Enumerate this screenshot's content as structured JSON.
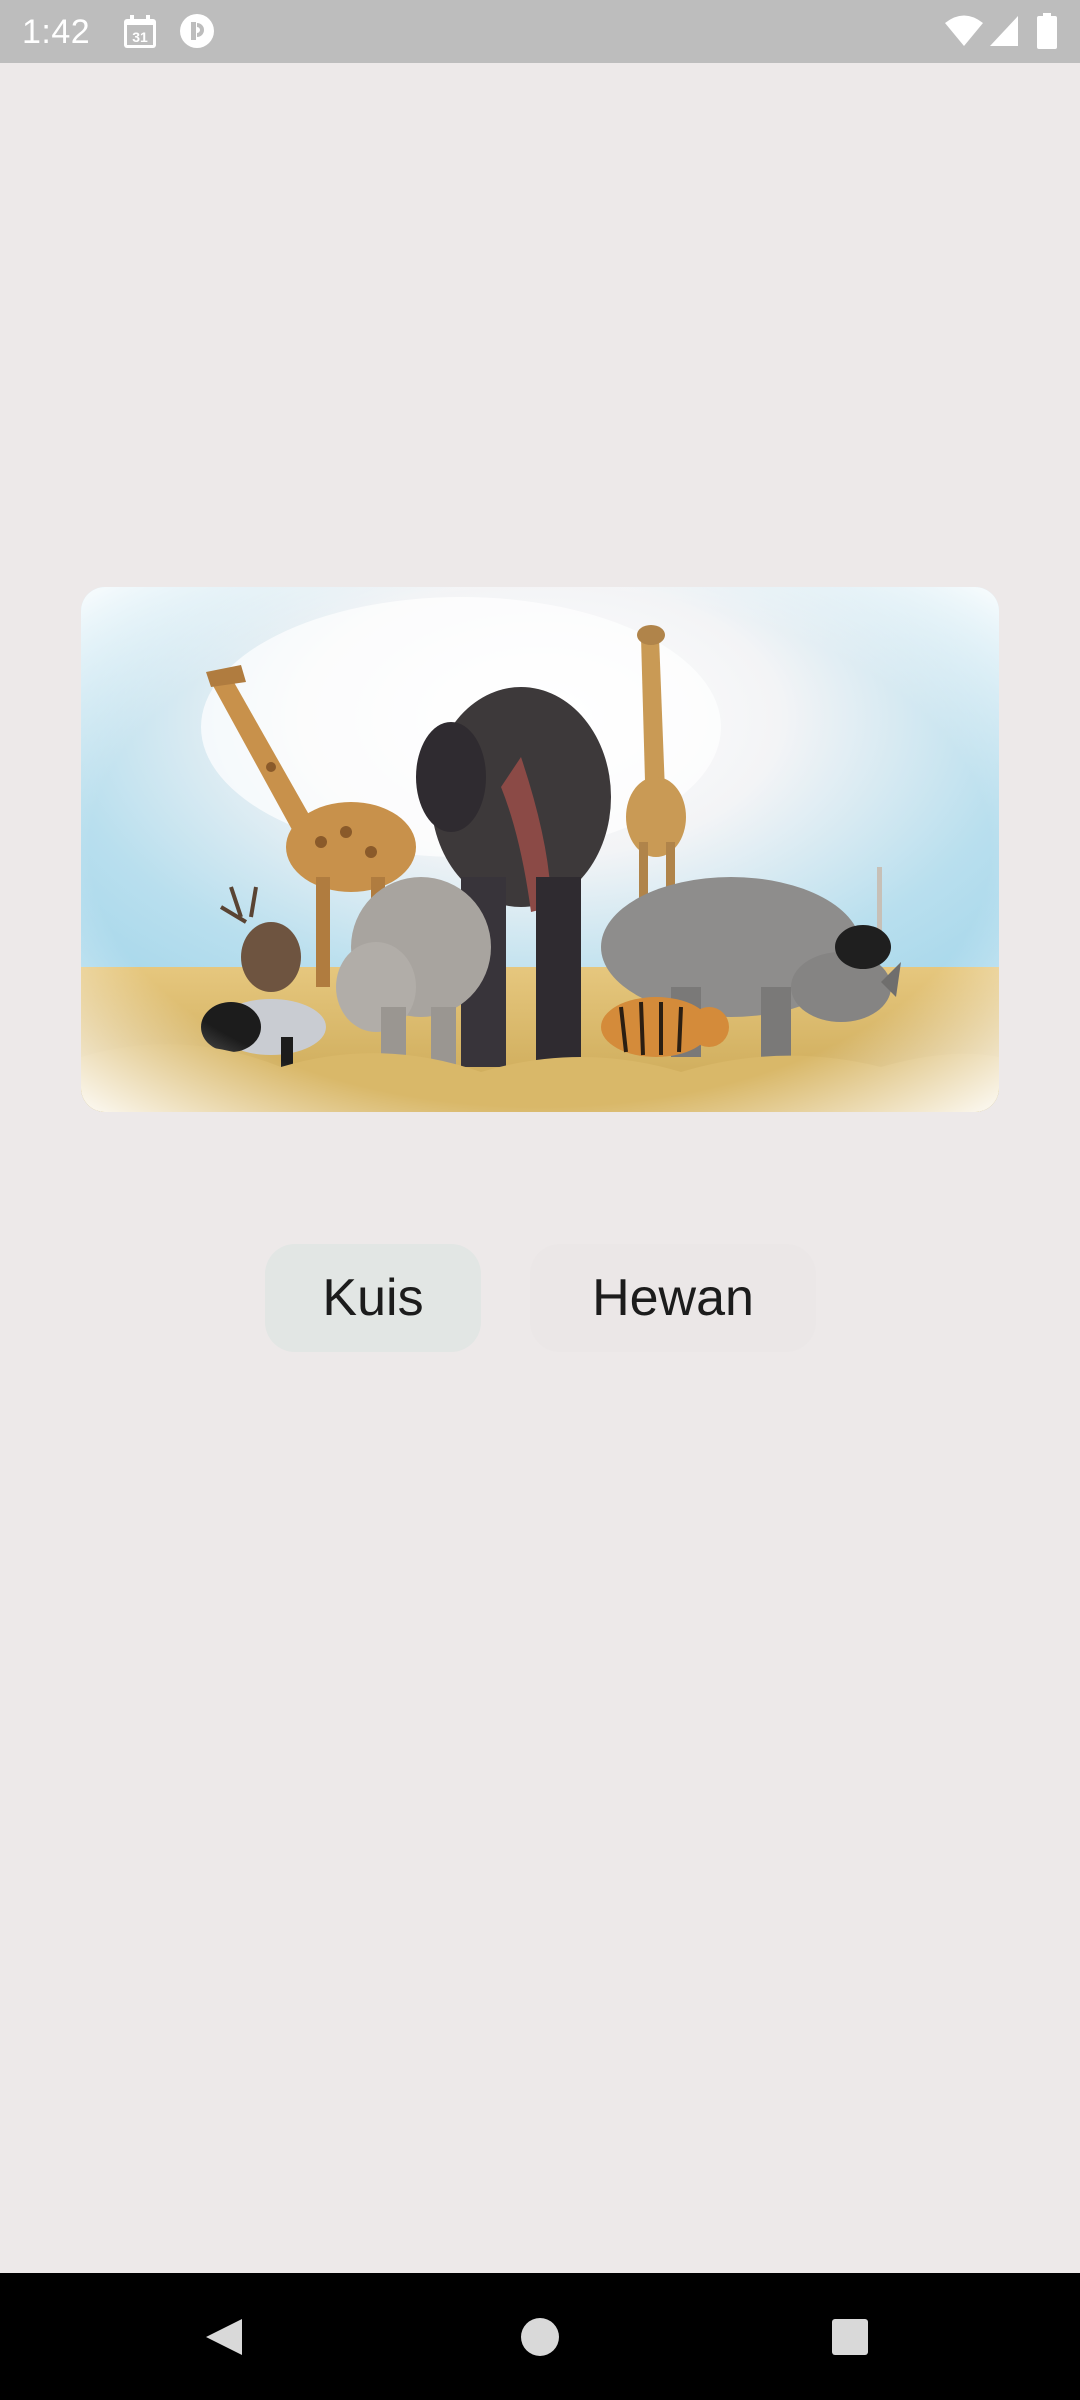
{
  "status_bar": {
    "time": "1:42",
    "calendar_day": "31",
    "icons": [
      "calendar-icon",
      "cloud-app-icon",
      "wifi-icon",
      "signal-icon",
      "battery-icon"
    ]
  },
  "hero": {
    "image_subject": "wild-animals-group-image"
  },
  "buttons": {
    "quiz_label": "Kuis",
    "animals_label": "Hewan"
  },
  "nav_bar": {
    "icons": [
      "back-icon",
      "home-icon",
      "recents-icon"
    ]
  },
  "colors": {
    "background": "#ede9e9",
    "status_bar": "#bdbdbd",
    "quiz_button": "#e2e6e4",
    "animals_button": "#ebe7e7",
    "nav_bar": "#000000"
  }
}
